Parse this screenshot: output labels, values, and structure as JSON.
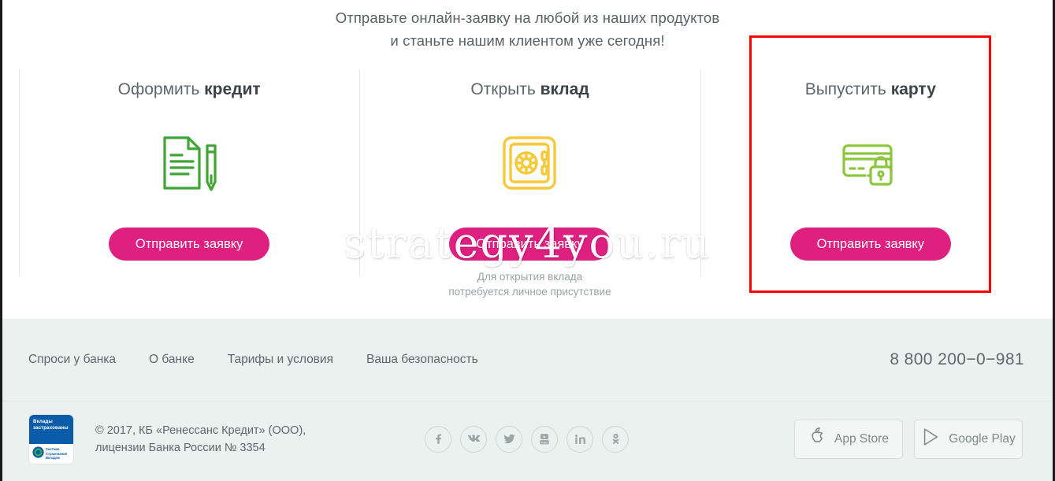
{
  "headline": {
    "line1": "Отправьте онлайн-заявку на любой из наших продуктов",
    "line2": "и станьте нашим клиентом уже сегодня!"
  },
  "watermark": "strategy4you.ru",
  "cards": [
    {
      "title_light": "Оформить ",
      "title_bold": "кредит",
      "icon": "document-pen-icon",
      "icon_color": "#3FA535",
      "cta": "Отправить заявку",
      "note": ""
    },
    {
      "title_light": "Открыть ",
      "title_bold": "вклад",
      "icon": "safe-icon",
      "icon_color": "#F5C93A",
      "cta": "Отправить заявку",
      "note_line1": "Для открытия вклада",
      "note_line2": "потребуется личное присутствие"
    },
    {
      "title_light": "Выпустить ",
      "title_bold": "карту",
      "icon": "credit-card-lock-icon",
      "icon_color": "#8CC63E",
      "cta": "Отправить заявку",
      "note": ""
    }
  ],
  "highlight": {
    "color": "#ff0000"
  },
  "footer": {
    "links": [
      "Спроси у банка",
      "О банке",
      "Тарифы и условия",
      "Ваша безопасность"
    ],
    "phone": "8 800 200−0−981",
    "badge": {
      "top_line1": "Вклады",
      "top_line2": "застрахованы",
      "bottom_line1": "Система",
      "bottom_line2": "Страхования",
      "bottom_line3": "Вкладов"
    },
    "copyright_line1": "© 2017, КБ «Ренессанс Кредит» (ООО),",
    "copyright_line2": "лицензии Банка России № 3354",
    "socials": [
      "facebook-icon",
      "vk-icon",
      "twitter-icon",
      "youtube-icon",
      "linkedin-icon",
      "odnoklassniki-icon"
    ],
    "stores": [
      {
        "icon": "apple-icon",
        "label": "App Store"
      },
      {
        "icon": "google-play-icon",
        "label": "Google Play"
      }
    ]
  },
  "colors": {
    "cta_pink": "#DE2080",
    "footer_bg": "#EBF1EF",
    "highlight_red": "#ff0000",
    "badge_blue": "#0b5ca8"
  }
}
